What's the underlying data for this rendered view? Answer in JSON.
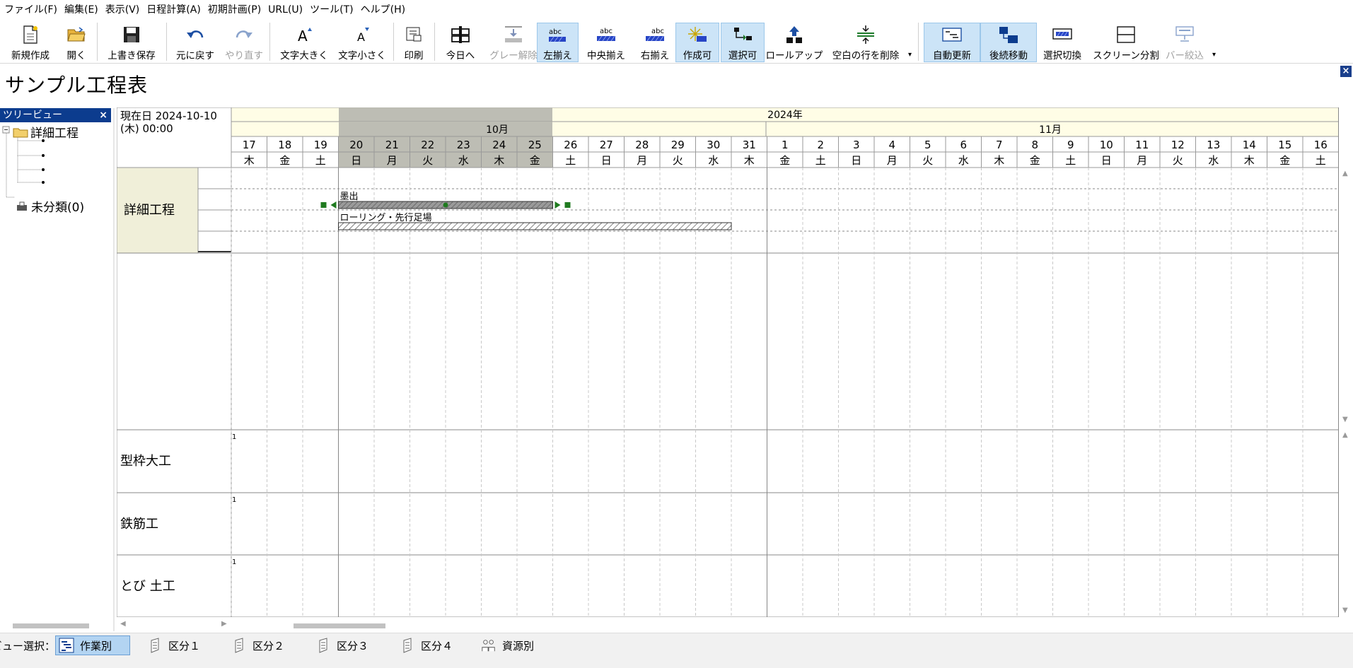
{
  "menu": [
    {
      "id": "file",
      "label": "ファイル(F)"
    },
    {
      "id": "edit",
      "label": "編集(E)"
    },
    {
      "id": "view",
      "label": "表示(V)"
    },
    {
      "id": "schedule-calc",
      "label": "日程計算(A)"
    },
    {
      "id": "initial-plan",
      "label": "初期計画(P)"
    },
    {
      "id": "url",
      "label": "URL(U)"
    },
    {
      "id": "tools",
      "label": "ツール(T)"
    },
    {
      "id": "help",
      "label": "ヘルプ(H)"
    }
  ],
  "toolbar": {
    "new": "新規作成",
    "open": "開く",
    "save": "上書き保存",
    "undo": "元に戻す",
    "redo": "やり直す",
    "font_up": "文字大きく",
    "font_down": "文字小さく",
    "print": "印刷",
    "today": "今日へ",
    "gray_clear": "グレー解除",
    "align_left": "左揃え",
    "align_center": "中央揃え",
    "align_right": "右揃え",
    "create": "作成可",
    "select": "選択可",
    "rollup": "ロールアップ",
    "delete_blank": "空白の行を削除",
    "auto_update": "自動更新",
    "follow_move": "後続移動",
    "select_switch": "選択切換",
    "screen_split": "スクリーン分割",
    "bar_filter": "バー絞込",
    "abc_text": "abc"
  },
  "page_title": "サンプル工程表",
  "tree": {
    "header": "ツリービュー",
    "root": "詳細工程",
    "uncategorized": "未分類(0)"
  },
  "gantt": {
    "current_date": "現在日 2024-10-10",
    "current_time": "(木) 00:00",
    "year": "2024年",
    "month_oct": "10月",
    "month_nov": "11月",
    "days": [
      {
        "d": "17",
        "w": "木"
      },
      {
        "d": "18",
        "w": "金"
      },
      {
        "d": "19",
        "w": "土"
      },
      {
        "d": "20",
        "w": "日"
      },
      {
        "d": "21",
        "w": "月"
      },
      {
        "d": "22",
        "w": "火"
      },
      {
        "d": "23",
        "w": "水"
      },
      {
        "d": "24",
        "w": "木"
      },
      {
        "d": "25",
        "w": "金"
      },
      {
        "d": "26",
        "w": "土"
      },
      {
        "d": "27",
        "w": "日"
      },
      {
        "d": "28",
        "w": "月"
      },
      {
        "d": "29",
        "w": "火"
      },
      {
        "d": "30",
        "w": "水"
      },
      {
        "d": "31",
        "w": "木"
      },
      {
        "d": "1",
        "w": "金"
      },
      {
        "d": "2",
        "w": "土"
      },
      {
        "d": "3",
        "w": "日"
      },
      {
        "d": "4",
        "w": "月"
      },
      {
        "d": "5",
        "w": "火"
      },
      {
        "d": "6",
        "w": "水"
      },
      {
        "d": "7",
        "w": "木"
      },
      {
        "d": "8",
        "w": "金"
      },
      {
        "d": "9",
        "w": "土"
      },
      {
        "d": "10",
        "w": "日"
      },
      {
        "d": "11",
        "w": "月"
      },
      {
        "d": "12",
        "w": "火"
      },
      {
        "d": "13",
        "w": "水"
      },
      {
        "d": "14",
        "w": "木"
      },
      {
        "d": "15",
        "w": "金"
      },
      {
        "d": "16",
        "w": "土"
      }
    ],
    "gray_range": {
      "start": "2024-10-20",
      "end": "2024-10-25"
    },
    "task_group": "詳細工程",
    "tasks": [
      {
        "name": "墨出",
        "start": "2024-10-20",
        "end": "2024-10-25",
        "selected": true
      },
      {
        "name": "ローリング・先行足場",
        "start": "2024-10-20",
        "end": "2024-10-30",
        "selected": false
      }
    ],
    "resources": [
      {
        "name": "型枠大工",
        "value": "1"
      },
      {
        "name": "鉄筋工",
        "value": "1"
      },
      {
        "name": "とび 土工",
        "value": "1"
      }
    ]
  },
  "bottom": {
    "view_label": "ビュー選択：",
    "tabs": [
      {
        "id": "by-task",
        "label": "作業別",
        "active": true
      },
      {
        "id": "cat1",
        "label": "区分１",
        "active": false
      },
      {
        "id": "cat2",
        "label": "区分２",
        "active": false
      },
      {
        "id": "cat3",
        "label": "区分３",
        "active": false
      },
      {
        "id": "cat4",
        "label": "区分４",
        "active": false
      },
      {
        "id": "by-resource",
        "label": "資源別",
        "active": false
      }
    ]
  },
  "colors": {
    "selected_bg": "#cce4f7",
    "header_bg": "#fffde6",
    "gray_band": "#bdbdb4",
    "tree_header": "#0c3c8e",
    "handle_green": "#1f7a1f"
  }
}
